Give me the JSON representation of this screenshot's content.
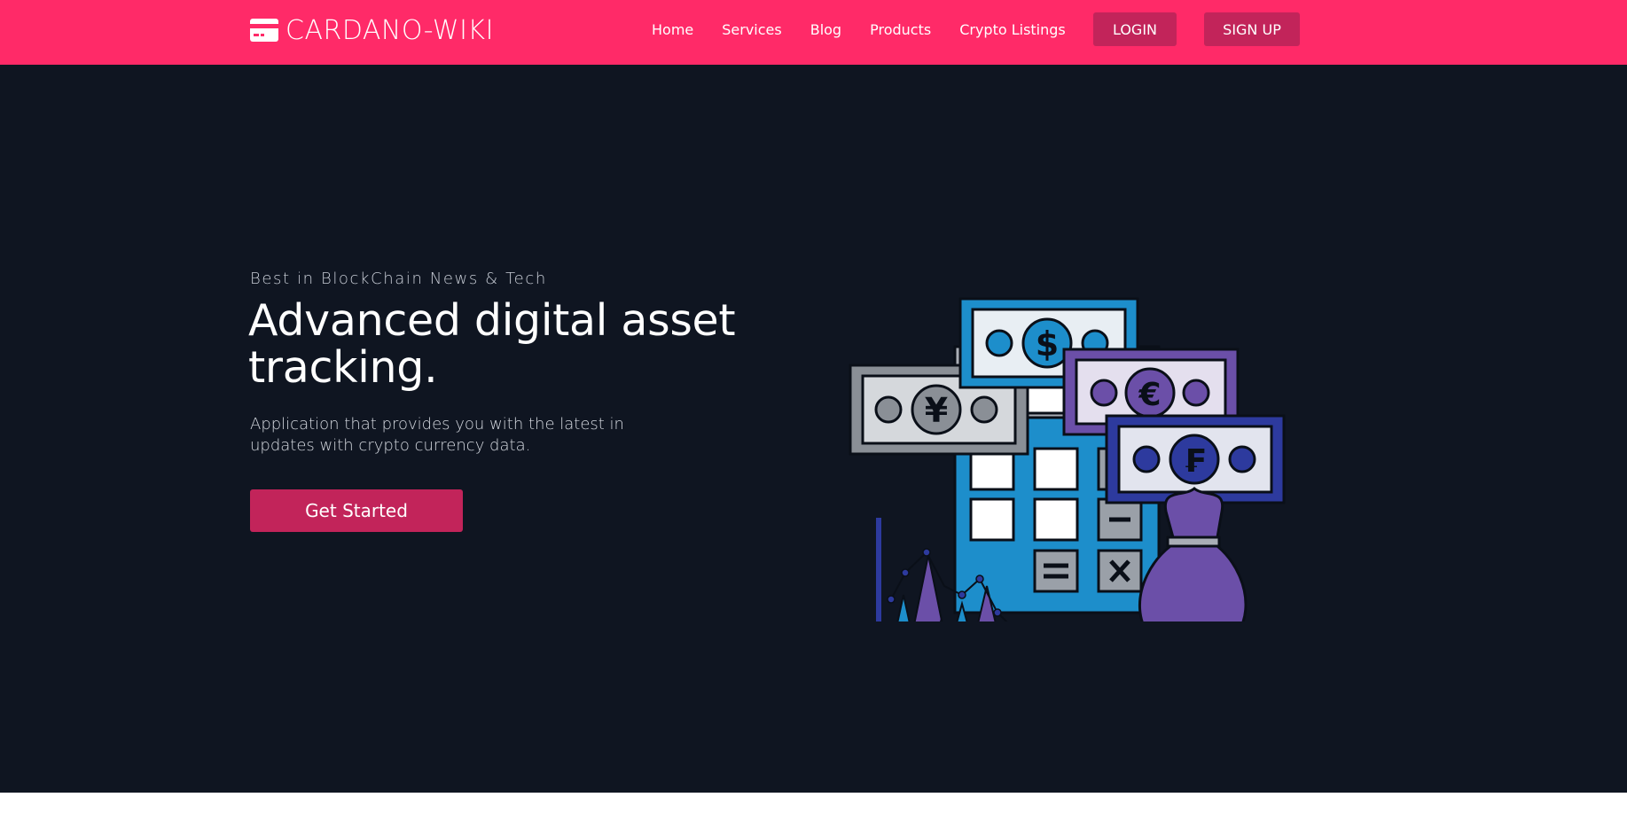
{
  "nav": {
    "brand_name": "CARDANO-WIKI",
    "brand_icon": "credit-card-icon",
    "links": [
      "Home",
      "Services",
      "Blog",
      "Products",
      "Crypto Listings"
    ],
    "login_label": "LOGIN",
    "signup_label": "SIGN UP"
  },
  "hero": {
    "eyebrow": "Best in BlockChain News & Tech",
    "headline": "Advanced digital asset tracking.",
    "subtext": "Application that provides you with the latest in updates with crypto currency data.",
    "cta_label": "Get Started",
    "illustration": {
      "currency_symbols": [
        "$",
        "€",
        "¥",
        "₣"
      ],
      "icon": "finance-calculator-illustration"
    }
  },
  "colors": {
    "navbar_bg": "#ff2a68",
    "hero_bg": "#0f1521",
    "button_bg": "#c2245a",
    "accent_blue": "#1a8ccc",
    "accent_purple": "#6b4fa8"
  }
}
